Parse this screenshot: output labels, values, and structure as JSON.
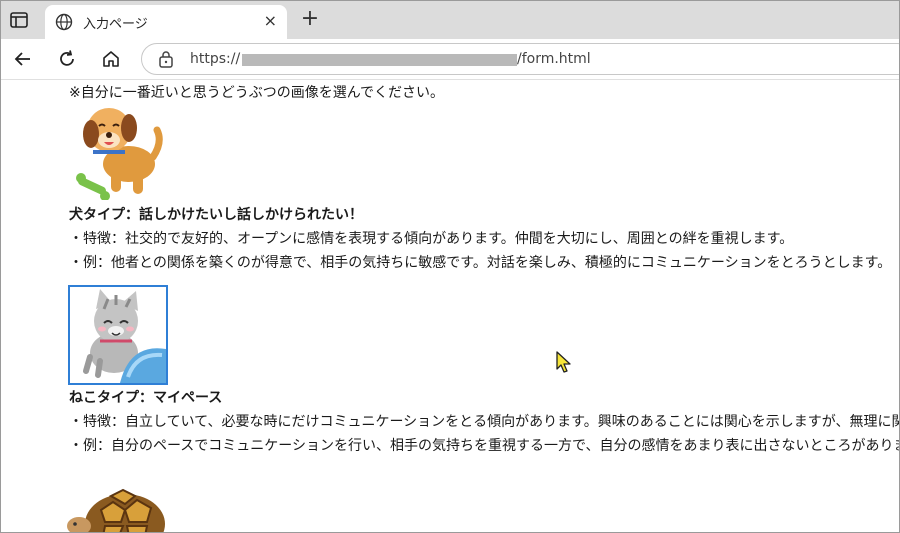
{
  "browser": {
    "tab_title": "入力ページ",
    "tab_close": "×",
    "new_tab": "+",
    "url_prefix": "https://",
    "url_suffix": "/form.html"
  },
  "page": {
    "instruction": "※自分に一番近いと思うどうぶつの画像を選んでください。",
    "types": [
      {
        "animal_icon": "dog-illustration",
        "title": "犬タイプ：話しかけたいし話しかけられたい！",
        "trait": "・特徴：社交的で友好的、オープンに感情を表現する傾向があります。仲間を大切にし、周囲との絆を重視します。",
        "example": "・例：他者との関係を築くのが得意で、相手の気持ちに敏感です。対話を楽しみ、積極的にコミュニケーションをとろうとします。"
      },
      {
        "animal_icon": "cat-illustration",
        "title": "ねこタイプ：マイペース",
        "trait": "・特徴：自立していて、必要な時にだけコミュニケーションをとる傾向があります。興味のあることには関心を示しますが、無理に関わるこ",
        "example": "・例：自分のペースでコミュニケーションを行い、相手の気持ちを重視する一方で、自分の感情をあまり表に出さないところがあります。"
      },
      {
        "animal_icon": "tortoise-illustration"
      }
    ]
  },
  "colors": {
    "selected_border": "#2f7fd6",
    "tabstrip": "#dcdcdc"
  }
}
